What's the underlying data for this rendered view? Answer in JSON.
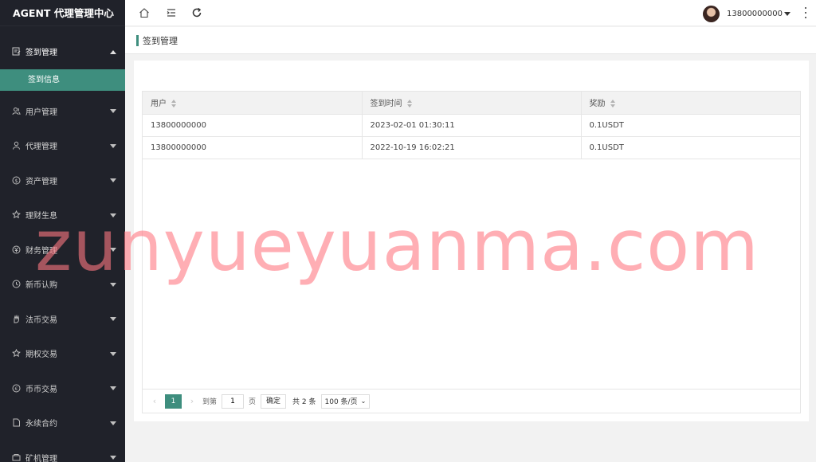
{
  "app": {
    "title": "AGENT 代理管理中心"
  },
  "sidebar": {
    "items": [
      {
        "label": "签到管理",
        "icon": "checkin-icon",
        "open": true,
        "sub": [
          {
            "label": "签到信息"
          }
        ]
      },
      {
        "label": "用户管理",
        "icon": "users-icon"
      },
      {
        "label": "代理管理",
        "icon": "user-icon"
      },
      {
        "label": "资产管理",
        "icon": "dollar-icon"
      },
      {
        "label": "理财生息",
        "icon": "star-icon"
      },
      {
        "label": "财务管理",
        "icon": "finance-icon"
      },
      {
        "label": "新币认购",
        "icon": "clock-icon"
      },
      {
        "label": "法币交易",
        "icon": "hand-icon"
      },
      {
        "label": "期权交易",
        "icon": "star-icon"
      },
      {
        "label": "币币交易",
        "icon": "coin-icon"
      },
      {
        "label": "永续合约",
        "icon": "document-icon"
      },
      {
        "label": "矿机管理",
        "icon": "miner-icon"
      }
    ]
  },
  "header": {
    "user_name": "13800000000"
  },
  "page": {
    "title": "签到管理"
  },
  "table": {
    "columns": [
      "用户",
      "签到时间",
      "奖励"
    ],
    "rows": [
      [
        "13800000000",
        "2023-02-01 01:30:11",
        "0.1USDT"
      ],
      [
        "13800000000",
        "2022-10-19 16:02:21",
        "0.1USDT"
      ]
    ]
  },
  "pager": {
    "current": "1",
    "goto_label": "到第",
    "goto_value": "1",
    "page_unit": "页",
    "confirm": "确定",
    "total": "共 2 条",
    "page_size": "100 条/页"
  },
  "watermark": "zunyueyuanma.com",
  "colors": {
    "accent": "#3e8e7e",
    "sidebar_bg": "#20222a"
  }
}
